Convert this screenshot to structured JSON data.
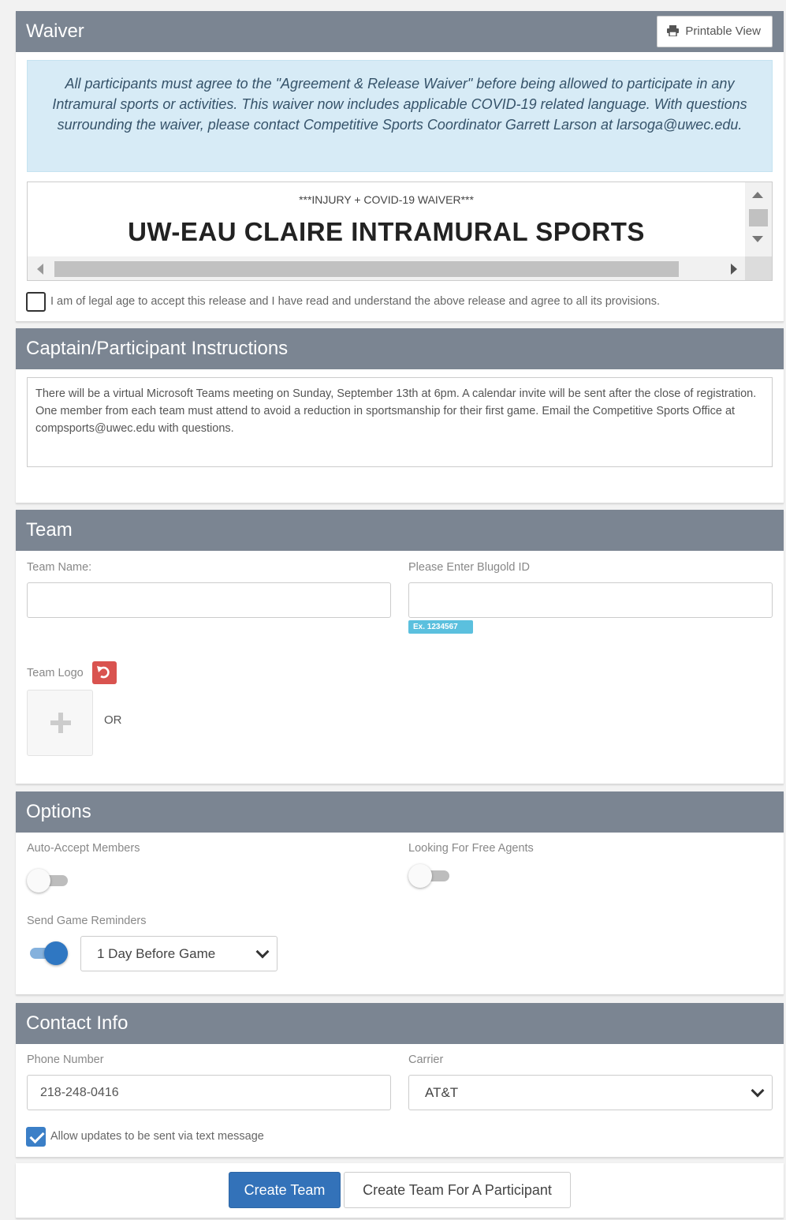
{
  "waiver": {
    "title": "Waiver",
    "printable_view": "Printable View",
    "notice": "All participants must agree to the \"Agreement & Release Waiver\" before being allowed to participate in any Intramural sports or activities. This waiver now includes applicable COVID-19 related language. With questions surrounding the waiver, please contact Competitive Sports Coordinator Garrett Larson at larsoga@uwec.edu.",
    "document_subtitle": "***INJURY + COVID-19 WAIVER***",
    "document_title": "UW-EAU CLAIRE INTRAMURAL SPORTS",
    "agree_label": "I am of legal age to accept this release and I have read and understand the above release and agree to all its provisions."
  },
  "instructions": {
    "title": "Captain/Participant Instructions",
    "text": "There will be a virtual Microsoft Teams meeting on Sunday, September 13th at 6pm. A calendar invite will be sent after the close of registration. One member from each team must attend to avoid a reduction in sportsmanship for their first game. Email the Competitive Sports Office at compsports@uwec.edu with questions."
  },
  "team": {
    "title": "Team",
    "team_name_label": "Team Name:",
    "team_name_value": "",
    "blugold_label": "Please Enter Blugold ID",
    "blugold_value": "",
    "blugold_example": "Ex. 1234567",
    "logo_label": "Team Logo",
    "or_text": "OR"
  },
  "options": {
    "title": "Options",
    "auto_accept_label": "Auto-Accept Members",
    "auto_accept_on": false,
    "free_agents_label": "Looking For Free Agents",
    "free_agents_on": false,
    "reminders_label": "Send Game Reminders",
    "reminders_on": true,
    "reminder_selected": "1 Day Before Game"
  },
  "contact": {
    "title": "Contact Info",
    "phone_label": "Phone Number",
    "phone_value": "218-248-0416",
    "carrier_label": "Carrier",
    "carrier_selected": "AT&T",
    "sms_label": "Allow updates to be sent via text message",
    "sms_checked": true
  },
  "actions": {
    "create_team": "Create Team",
    "create_for_participant": "Create Team For A Participant"
  },
  "colors": {
    "panel_header": "#7b8592",
    "primary": "#3372b9",
    "danger": "#d9534f",
    "info": "#5bc0de",
    "alert_bg": "#d7ebf6"
  }
}
